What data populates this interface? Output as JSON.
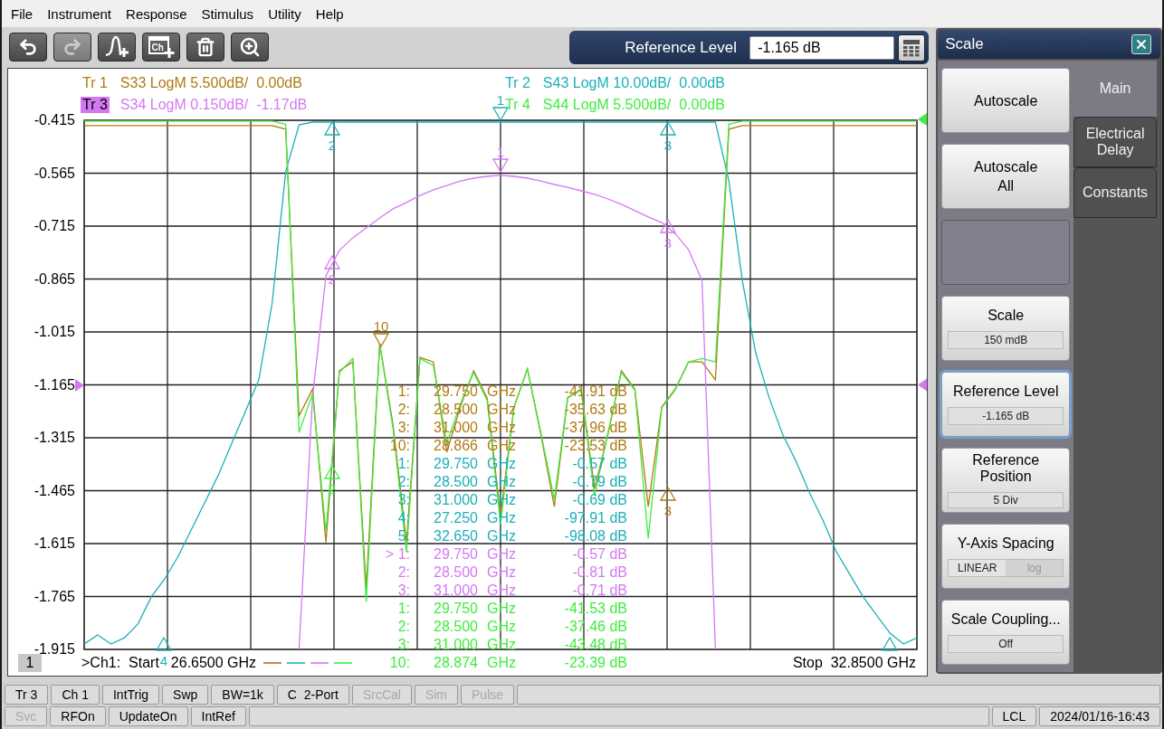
{
  "menu": [
    "File",
    "Instrument",
    "Response",
    "Stimulus",
    "Utility",
    "Help"
  ],
  "toolbar": {
    "buttons": [
      {
        "kind": "undo",
        "disabled": false
      },
      {
        "kind": "redo",
        "disabled": true
      },
      {
        "kind": "add-trace",
        "disabled": false
      },
      {
        "kind": "add-channel",
        "text": "Ch",
        "disabled": false
      },
      {
        "kind": "delete",
        "disabled": false
      },
      {
        "kind": "zoom",
        "disabled": false
      }
    ],
    "entry": {
      "label": "Reference Level",
      "value": "-1.165 dB"
    }
  },
  "traces": [
    {
      "desc": "S33 LogM 5.500dB/  0.00dB",
      "color": "#b07a12",
      "selected": false
    },
    {
      "desc": "S43 LogM 10.00dB/  0.00dB",
      "color": "#1bb0b8",
      "selected": false
    },
    {
      "desc": "S34 LogM 0.150dB/  -1.17dB",
      "color": "#d478f2",
      "selected": true
    },
    {
      "desc": "S44 LogM 5.500dB/  0.00dB",
      "color": "#3fec3f",
      "selected": false
    }
  ],
  "chart_data": {
    "type": "line",
    "grid": true,
    "ylim": [
      -1.915,
      -0.415
    ],
    "yticks": [
      {
        "value": -0.415,
        "label": "-0.415"
      },
      {
        "value": -0.565,
        "label": "-0.565"
      },
      {
        "value": -0.715,
        "label": "-0.715"
      },
      {
        "value": -0.865,
        "label": "-0.865"
      },
      {
        "value": -1.015,
        "label": "-1.015"
      },
      {
        "value": -1.165,
        "label": "-1.165"
      },
      {
        "value": -1.315,
        "label": "-1.315"
      },
      {
        "value": -1.465,
        "label": "-1.465"
      },
      {
        "value": -1.615,
        "label": "-1.615"
      },
      {
        "value": -1.765,
        "label": "-1.765"
      },
      {
        "value": -1.915,
        "label": "-1.915"
      }
    ],
    "categories": [
      null,
      null,
      null,
      null,
      null,
      null,
      null,
      null,
      null,
      null,
      null,
      null,
      null,
      null,
      null,
      null,
      null,
      null,
      null,
      null,
      null,
      null,
      null,
      null,
      null,
      null,
      null,
      null,
      null,
      null,
      null,
      null,
      null,
      null,
      null,
      null,
      null,
      null,
      null,
      null,
      null,
      null,
      null,
      null,
      null,
      null,
      null,
      null,
      null,
      null,
      null,
      null,
      null,
      null,
      null,
      null,
      null,
      null,
      null,
      null,
      null,
      null,
      null
    ],
    "series": [
      {
        "name": "Tr 1",
        "color": "#b07a12",
        "values": [
          -0.43,
          -0.43,
          -0.43,
          -0.43,
          -0.43,
          -0.43,
          -0.43,
          -0.43,
          -0.43,
          -0.43,
          -0.43,
          -0.43,
          -0.43,
          -0.43,
          -0.43,
          -0.44,
          -1.253,
          -1.177,
          -1.612,
          -1.125,
          -1.1,
          -1.741,
          -1.048,
          -1.279,
          -1.612,
          -1.087,
          -1.1,
          -1.356,
          -1.228,
          -1.125,
          -1.202,
          -1.535,
          -1.228,
          -1.12,
          -1.305,
          -1.51,
          -1.202,
          -1.177,
          -1.459,
          -1.305,
          -1.125,
          -1.177,
          -1.51,
          -1.228,
          -1.177,
          -1.1,
          -1.1,
          -1.151,
          -0.44,
          -0.43,
          -0.43,
          -0.43,
          -0.43,
          -0.43,
          -0.43,
          -0.43,
          -0.43,
          -0.43,
          -0.43,
          -0.43,
          -0.43,
          -0.43,
          -0.43
        ]
      },
      {
        "name": "Tr 2",
        "color": "#1bb0b8",
        "values": [
          -1.9,
          -1.874,
          -1.9,
          -1.882,
          -1.843,
          -1.766,
          -1.715,
          -1.651,
          -1.574,
          -1.497,
          -1.42,
          -1.33,
          -1.241,
          -1.151,
          -0.933,
          -0.561,
          -0.428,
          -0.42,
          -0.42,
          -0.42,
          -0.42,
          -0.42,
          -0.42,
          -0.42,
          -0.42,
          -0.42,
          -0.42,
          -0.42,
          -0.42,
          -0.42,
          -0.42,
          -0.42,
          -0.42,
          -0.42,
          -0.42,
          -0.42,
          -0.42,
          -0.42,
          -0.42,
          -0.42,
          -0.42,
          -0.42,
          -0.42,
          -0.42,
          -0.42,
          -0.42,
          -0.42,
          -0.42,
          -0.587,
          -0.869,
          -1.074,
          -1.202,
          -1.305,
          -1.382,
          -1.471,
          -1.548,
          -1.638,
          -1.702,
          -1.766,
          -1.818,
          -1.869,
          -1.9,
          -1.882
        ]
      },
      {
        "name": "Tr 3",
        "color": "#d478f2",
        "values": [
          null,
          null,
          null,
          null,
          null,
          null,
          null,
          null,
          null,
          null,
          null,
          null,
          null,
          null,
          null,
          null,
          -1.915,
          -1.2,
          -0.856,
          -0.784,
          -0.748,
          -0.72,
          -0.692,
          -0.666,
          -0.648,
          -0.628,
          -0.612,
          -0.6,
          -0.587,
          -0.579,
          -0.574,
          -0.571,
          -0.574,
          -0.579,
          -0.587,
          -0.597,
          -0.605,
          -0.615,
          -0.625,
          -0.638,
          -0.653,
          -0.671,
          -0.689,
          -0.705,
          -0.736,
          -0.782,
          -0.869,
          -1.915,
          null,
          null,
          null,
          null,
          null,
          null,
          null,
          null,
          null,
          null,
          null,
          null,
          null,
          null,
          null
        ]
      },
      {
        "name": "Tr 4",
        "color": "#3fec3f",
        "values": [
          -0.417,
          -0.417,
          -0.417,
          -0.417,
          -0.417,
          -0.417,
          -0.417,
          -0.417,
          -0.417,
          -0.417,
          -0.417,
          -0.417,
          -0.417,
          -0.417,
          -0.417,
          -0.426,
          -1.3,
          -1.19,
          -1.58,
          -1.13,
          -1.09,
          -1.78,
          -1.05,
          -1.29,
          -1.64,
          -1.09,
          -1.11,
          -1.33,
          -1.22,
          -1.13,
          -1.21,
          -1.56,
          -1.23,
          -1.12,
          -1.3,
          -1.49,
          -1.2,
          -1.18,
          -1.48,
          -1.3,
          -1.13,
          -1.18,
          -1.6,
          -1.23,
          -1.18,
          -1.1,
          -1.09,
          -1.1,
          -0.426,
          -0.417,
          -0.417,
          -0.417,
          -0.417,
          -0.417,
          -0.417,
          -0.417,
          -0.417,
          -0.417,
          -0.417,
          -0.417,
          -0.417,
          -0.417,
          -0.417
        ]
      }
    ]
  },
  "plot_markers": [
    {
      "label": "1",
      "color": "#1bb0b8"
    },
    {
      "label": "2",
      "color": "#1bb0b8"
    },
    {
      "label": "3",
      "color": "#1bb0b8"
    },
    {
      "label": "1",
      "color": "#d478f2"
    },
    {
      "label": "2",
      "color": "#d478f2"
    },
    {
      "label": "3",
      "color": "#d478f2"
    },
    {
      "label": "10",
      "color": "#b07a12"
    },
    {
      "label": "2",
      "color": "#3fec3f"
    },
    {
      "label": "3",
      "color": "#b07a12"
    },
    {
      "label": "4",
      "color": "#1bb0b8"
    },
    {
      "color": "#1bb0b8"
    }
  ],
  "marker_table": [
    {
      "marker": "1:",
      "freq": "29.750",
      "unit": "GHz",
      "value": "-41.91 dB",
      "color": "#b07a12"
    },
    {
      "marker": "2:",
      "freq": "28.500",
      "unit": "GHz",
      "value": "-35.63 dB",
      "color": "#b07a12"
    },
    {
      "marker": "3:",
      "freq": "31.000",
      "unit": "GHz",
      "value": "-37.96 dB",
      "color": "#b07a12"
    },
    {
      "marker": "10:",
      "freq": "28.866",
      "unit": "GHz",
      "value": "-23.53 dB",
      "color": "#b07a12"
    },
    {
      "marker": "1:",
      "freq": "29.750",
      "unit": "GHz",
      "value": "-0.57 dB",
      "color": "#1bb0b8"
    },
    {
      "marker": "2:",
      "freq": "28.500",
      "unit": "GHz",
      "value": "-0.79 dB",
      "color": "#1bb0b8"
    },
    {
      "marker": "3:",
      "freq": "31.000",
      "unit": "GHz",
      "value": "-0.69 dB",
      "color": "#1bb0b8"
    },
    {
      "marker": "4:",
      "freq": "27.250",
      "unit": "GHz",
      "value": "-97.91 dB",
      "color": "#1bb0b8"
    },
    {
      "marker": "5:",
      "freq": "32.650",
      "unit": "GHz",
      "value": "-98.08 dB",
      "color": "#1bb0b8"
    },
    {
      "marker": "> 1:",
      "freq": "29.750",
      "unit": "GHz",
      "value": "-0.57 dB",
      "color": "#d478f2"
    },
    {
      "marker": "2:",
      "freq": "28.500",
      "unit": "GHz",
      "value": "-0.81 dB",
      "color": "#d478f2"
    },
    {
      "marker": "3:",
      "freq": "31.000",
      "unit": "GHz",
      "value": "-0.71 dB",
      "color": "#d478f2"
    },
    {
      "marker": "1:",
      "freq": "29.750",
      "unit": "GHz",
      "value": "-41.53 dB",
      "color": "#3fec3f"
    },
    {
      "marker": "2:",
      "freq": "28.500",
      "unit": "GHz",
      "value": "-37.46 dB",
      "color": "#3fec3f"
    },
    {
      "marker": "3:",
      "freq": "31.000",
      "unit": "GHz",
      "value": "-43.48 dB",
      "color": "#3fec3f"
    },
    {
      "marker": "10:",
      "freq": "28.874",
      "unit": "GHz",
      "value": "-23.39 dB",
      "color": "#3fec3f"
    }
  ],
  "footer": {
    "channel_box": "1",
    "start_label": ">Ch1:  Start",
    "start_value": "26.6500 GHz",
    "stop": "Stop  32.8500 GHz"
  },
  "panel": {
    "title": "Scale",
    "buttons": [
      {
        "kind": "action",
        "label": "Autoscale"
      },
      {
        "kind": "action",
        "label": "Autoscale All"
      },
      {
        "kind": "blank"
      },
      {
        "kind": "value",
        "label": "Scale",
        "value": "150 mdB",
        "focused": false
      },
      {
        "kind": "value",
        "label": "Reference Level",
        "value": "-1.165 dB",
        "focused": true
      },
      {
        "kind": "value",
        "label": "Reference Position",
        "value": "5 Div",
        "focused": false
      },
      {
        "kind": "toggle",
        "label": "Y-Axis Spacing",
        "options": [
          {
            "label": "LINEAR",
            "selected": true
          },
          {
            "label": "log",
            "selected": false
          }
        ]
      },
      {
        "kind": "value",
        "label": "Scale Coupling...",
        "value": "Off",
        "focused": false
      }
    ],
    "tabs": [
      {
        "label": "Main",
        "selected": true
      },
      {
        "label": "Electrical Delay",
        "selected": false
      },
      {
        "label": "Constants",
        "selected": false
      }
    ]
  },
  "status_bar": [
    {
      "left": [
        {
          "label": "Tr 3",
          "disabled": false
        },
        {
          "label": "Ch 1",
          "disabled": false
        },
        {
          "label": "IntTrig",
          "disabled": false
        },
        {
          "label": "Swp",
          "disabled": false
        },
        {
          "label": "BW=1k",
          "disabled": false
        },
        {
          "label": "C  2-Port",
          "disabled": false
        },
        {
          "label": "SrcCal",
          "disabled": true
        },
        {
          "label": "Sim",
          "disabled": true
        },
        {
          "label": "Pulse",
          "disabled": true
        }
      ]
    },
    {
      "left": [
        {
          "label": "Svc",
          "disabled": true
        },
        {
          "label": "RFOn",
          "disabled": false
        },
        {
          "label": "UpdateOn",
          "disabled": false
        },
        {
          "label": "IntRef",
          "disabled": false
        }
      ],
      "right": [
        {
          "label": "LCL",
          "disabled": false
        },
        {
          "label": "2024/01/16-16:43",
          "disabled": false
        }
      ]
    }
  ]
}
